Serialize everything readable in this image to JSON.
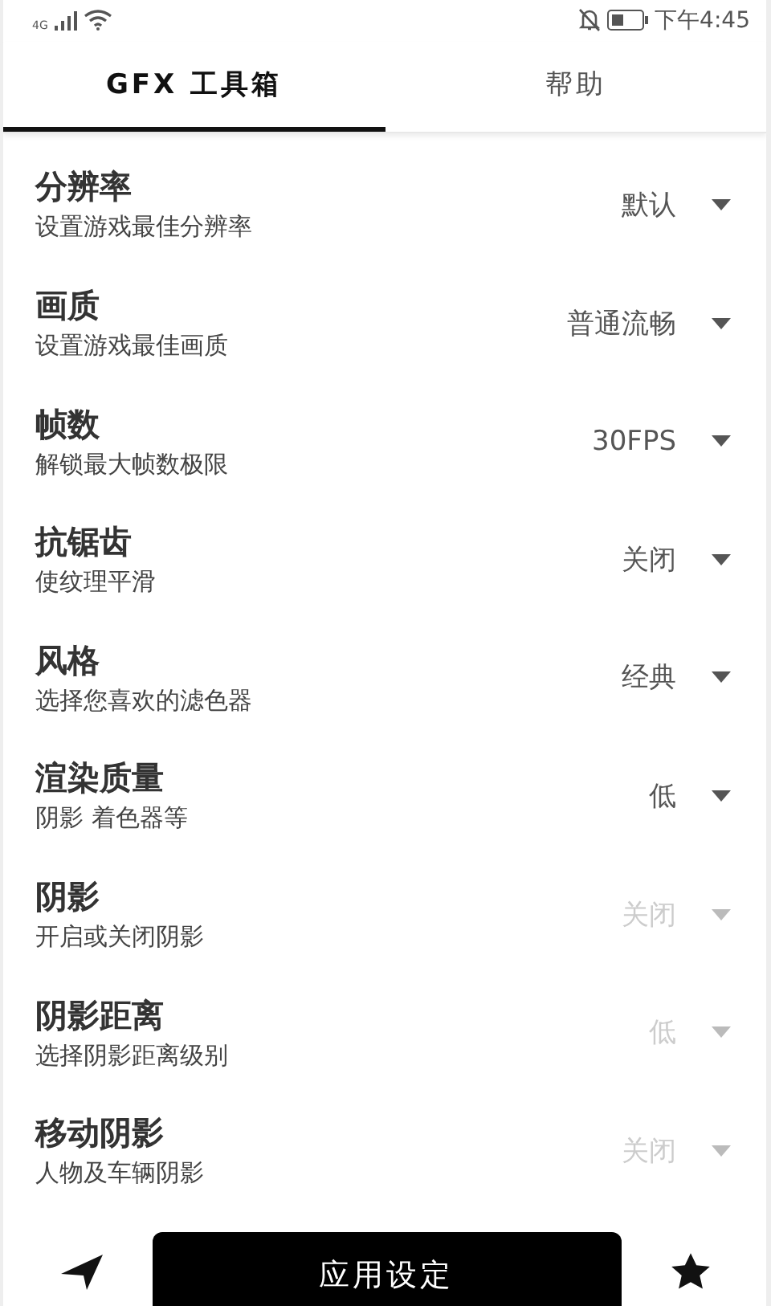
{
  "status_bar": {
    "network": "4G",
    "time": "下午4:45"
  },
  "tabs": [
    {
      "label": "GFX 工具箱",
      "selected": true
    },
    {
      "label": "帮助",
      "selected": false
    }
  ],
  "settings": [
    {
      "title": "分辨率",
      "subtitle": "设置游戏最佳分辨率",
      "value": "默认",
      "disabled": false
    },
    {
      "title": "画质",
      "subtitle": "设置游戏最佳画质",
      "value": "普通流畅",
      "disabled": false
    },
    {
      "title": "帧数",
      "subtitle": "解锁最大帧数极限",
      "value": "30FPS",
      "disabled": false
    },
    {
      "title": "抗锯齿",
      "subtitle": "使纹理平滑",
      "value": "关闭",
      "disabled": false
    },
    {
      "title": "风格",
      "subtitle": "选择您喜欢的滤色器",
      "value": "经典",
      "disabled": false
    },
    {
      "title": "渲染质量",
      "subtitle": "阴影 着色器等",
      "value": "低",
      "disabled": false
    },
    {
      "title": "阴影",
      "subtitle": "开启或关闭阴影",
      "value": "关闭",
      "disabled": true
    },
    {
      "title": "阴影距离",
      "subtitle": "选择阴影距离级别",
      "value": "低",
      "disabled": true
    },
    {
      "title": "移动阴影",
      "subtitle": "人物及车辆阴影",
      "value": "关闭",
      "disabled": true
    }
  ],
  "apply_button": {
    "label": "应用设定"
  }
}
